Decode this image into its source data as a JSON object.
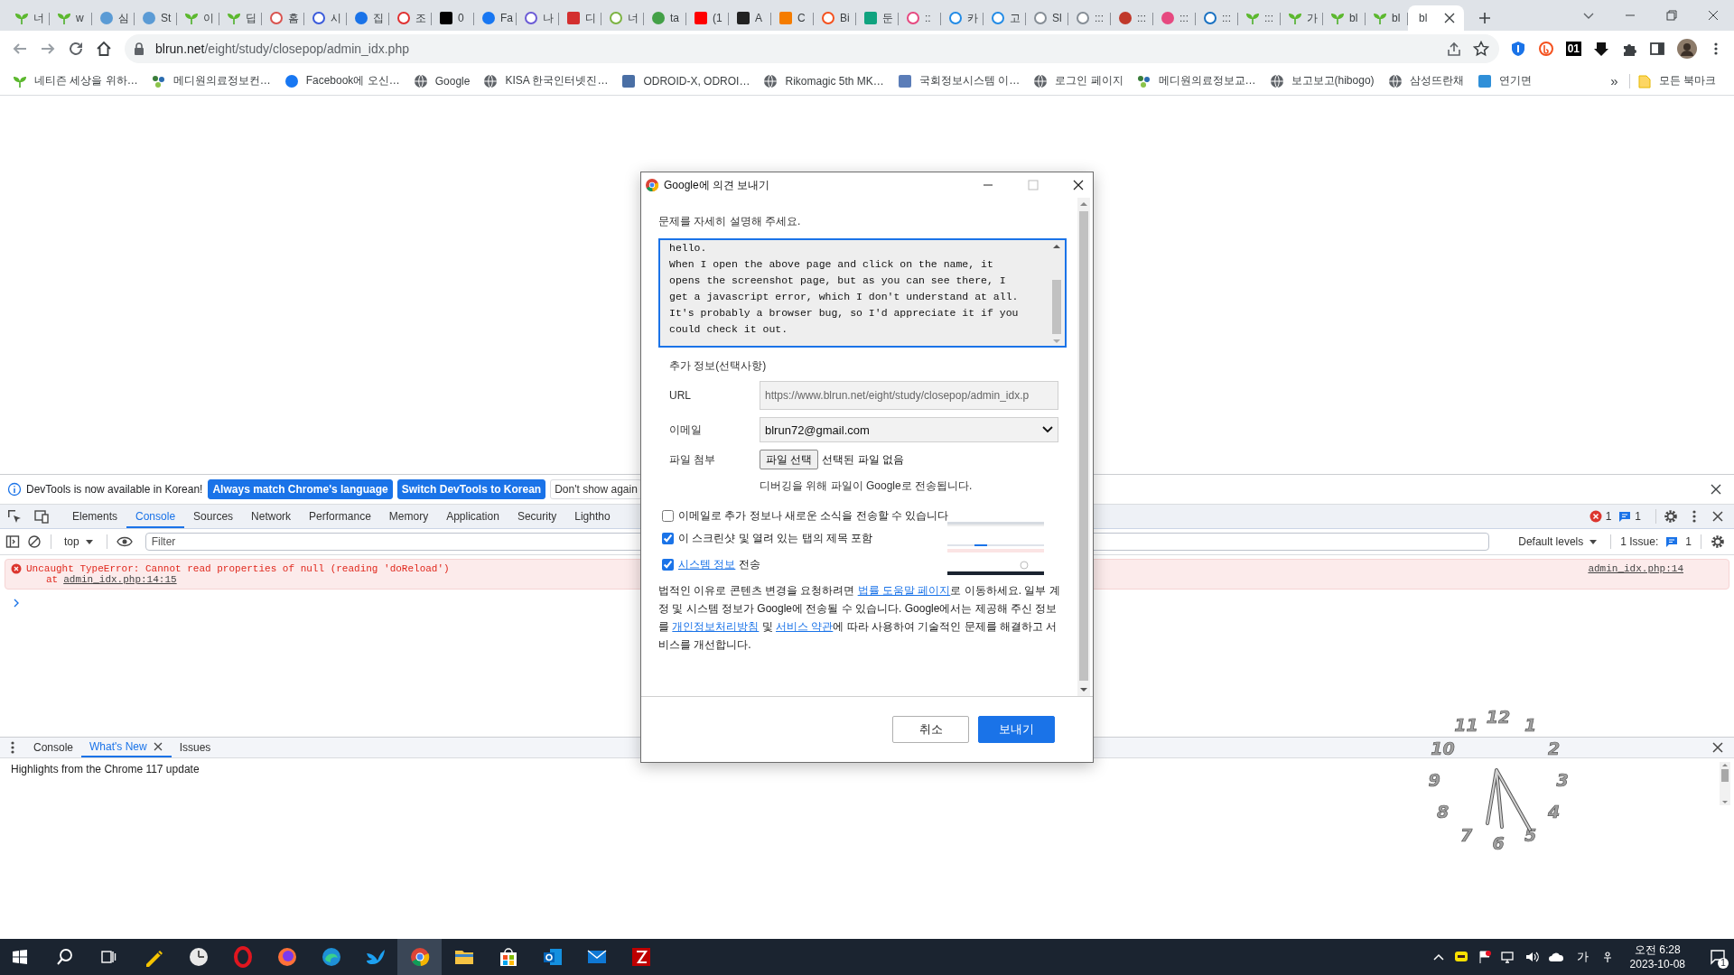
{
  "browser": {
    "tabs": [
      {
        "label": "너",
        "kind": "sprout",
        "selected": false
      },
      {
        "label": "w",
        "kind": "sprout",
        "selected": false
      },
      {
        "label": "심",
        "kind": "disc",
        "color": "#5b9bd5",
        "selected": false
      },
      {
        "label": "St",
        "kind": "disc",
        "color": "#5b9bd5",
        "selected": false
      },
      {
        "label": "이",
        "kind": "sprout",
        "selected": false
      },
      {
        "label": "딥",
        "kind": "sprout",
        "selected": false
      },
      {
        "label": "홈",
        "kind": "ring",
        "color": "#d9534f",
        "selected": false
      },
      {
        "label": "시",
        "kind": "ring",
        "color": "#3b5bdb",
        "selected": false
      },
      {
        "label": "집",
        "kind": "disc",
        "color": "#1a73e8",
        "selected": false
      },
      {
        "label": "조",
        "kind": "ring",
        "color": "#e03131",
        "selected": false
      },
      {
        "label": "0",
        "kind": "square",
        "color": "#000000",
        "selected": false
      },
      {
        "label": "Fa",
        "kind": "disc",
        "color": "#1877f2",
        "selected": false
      },
      {
        "label": "나",
        "kind": "ring",
        "color": "#6b5bd6",
        "selected": false
      },
      {
        "label": "디",
        "kind": "square",
        "color": "#d32f2f",
        "selected": false
      },
      {
        "label": "너",
        "kind": "ring",
        "color": "#7cb342",
        "selected": false
      },
      {
        "label": "ta",
        "kind": "disc",
        "color": "#43a047",
        "selected": false
      },
      {
        "label": "(1",
        "kind": "square",
        "color": "#ff0000",
        "selected": false
      },
      {
        "label": "A",
        "kind": "square",
        "color": "#222222",
        "selected": false
      },
      {
        "label": "C",
        "kind": "square",
        "color": "#f57c00",
        "selected": false
      },
      {
        "label": "Bi",
        "kind": "ring",
        "color": "#f4511e",
        "selected": false
      },
      {
        "label": "둔",
        "kind": "square",
        "color": "#10a37f",
        "selected": false
      },
      {
        "label": "::",
        "kind": "ring",
        "color": "#e64980",
        "selected": false
      },
      {
        "label": "카",
        "kind": "ring",
        "color": "#228be6",
        "selected": false
      },
      {
        "label": "고",
        "kind": "ring",
        "color": "#228be6",
        "selected": false
      },
      {
        "label": "Sl",
        "kind": "ring",
        "color": "#868e96",
        "selected": false
      },
      {
        "label": ":::",
        "kind": "ring",
        "color": "#868e96",
        "selected": false
      },
      {
        "label": ":::",
        "kind": "disc",
        "color": "#c0392b",
        "selected": false
      },
      {
        "label": ":::",
        "kind": "disc",
        "color": "#e64980",
        "selected": false
      },
      {
        "label": ":::",
        "kind": "ring",
        "color": "#1971c2",
        "selected": false
      },
      {
        "label": ":::",
        "kind": "sprout",
        "selected": false
      },
      {
        "label": "가",
        "kind": "sprout",
        "selected": false
      },
      {
        "label": "bl",
        "kind": "sprout",
        "selected": false
      },
      {
        "label": "bl",
        "kind": "sprout",
        "selected": false
      },
      {
        "label": "bl",
        "kind": "plain",
        "selected": true
      }
    ],
    "address": {
      "host": "blrun.net",
      "path": "/eight/study/closepop/admin_idx.php"
    },
    "extension_badge": "01",
    "bookmarks": [
      {
        "label": "네티즌 세상을 위하…",
        "kind": "sprout"
      },
      {
        "label": "메디원의료정보컨…",
        "kind": "dots"
      },
      {
        "label": "Facebook에 오신…",
        "kind": "disc",
        "color": "#1877f2"
      },
      {
        "label": "Google",
        "kind": "globe"
      },
      {
        "label": "KISA 한국인터넷진…",
        "kind": "globe"
      },
      {
        "label": "ODROID-X, ODROI…",
        "kind": "square",
        "color": "#4a6fa5"
      },
      {
        "label": "Rikomagic 5th MK…",
        "kind": "globe"
      },
      {
        "label": "국회정보시스템 이…",
        "kind": "square",
        "color": "#5b7db8"
      },
      {
        "label": "로그인 페이지",
        "kind": "globe"
      },
      {
        "label": "메디원의료정보교…",
        "kind": "dots"
      },
      {
        "label": "보고보고(hibogo)",
        "kind": "globe"
      },
      {
        "label": "삼성뜨란채",
        "kind": "globe"
      },
      {
        "label": "연기면",
        "kind": "square",
        "color": "#2f8fd8"
      }
    ],
    "bookmarks_overflow": "»",
    "all_bookmarks": "모든 북마크"
  },
  "devtools": {
    "infobar": {
      "message": "DevTools is now available in Korean!",
      "buttons": [
        {
          "label": "Always match Chrome's language",
          "kind": "primary"
        },
        {
          "label": "Switch DevTools to Korean",
          "kind": "primary"
        },
        {
          "label": "Don't show again",
          "kind": "plain"
        }
      ]
    },
    "tabs": [
      {
        "label": "Elements",
        "selected": false
      },
      {
        "label": "Console",
        "selected": true
      },
      {
        "label": "Sources",
        "selected": false
      },
      {
        "label": "Network",
        "selected": false
      },
      {
        "label": "Performance",
        "selected": false
      },
      {
        "label": "Memory",
        "selected": false
      },
      {
        "label": "Application",
        "selected": false
      },
      {
        "label": "Security",
        "selected": false
      },
      {
        "label": "Lightho",
        "selected": false
      }
    ],
    "error_count": "1",
    "message_count": "1",
    "console": {
      "context": "top",
      "filter_placeholder": "Filter",
      "levels": "Default levels",
      "issues_label": "1 Issue:",
      "issues_count": "1"
    },
    "messages": [
      {
        "kind": "error",
        "text": "Uncaught TypeError: Cannot read properties of null (reading 'doReload')",
        "trace_prefix": "at",
        "trace_link": "admin_idx.php:14:15",
        "source": "admin_idx.php:14"
      }
    ],
    "drawer": {
      "tabs": [
        {
          "label": "Console",
          "selected": false,
          "closable": false
        },
        {
          "label": "What's New",
          "selected": true,
          "closable": true
        },
        {
          "label": "Issues",
          "selected": false,
          "closable": false
        }
      ],
      "content": "Highlights from the Chrome 117 update"
    }
  },
  "dialog": {
    "title": "Google에 의견 보내기",
    "prompt": "문제를 자세히 설명해 주세요.",
    "description": "hello.\nWhen I open the above page and click on the name, it\nopens the screenshot page, but as you can see there, I\nget a javascript error, which I don't understand at all.\nIt's probably a browser bug, so I'd appreciate it if you\ncould check it out.",
    "section": "추가 정보(선택사항)",
    "fields": [
      {
        "label": "URL",
        "kind": "readonly",
        "value": "https://www.blrun.net/eight/study/closepop/admin_idx.p"
      },
      {
        "label": "이메일",
        "kind": "select",
        "value": "blrun72@gmail.com"
      },
      {
        "label": "파일 첨부",
        "kind": "file",
        "button": "파일 선택",
        "value": "선택된 파일 없음"
      }
    ],
    "file_note": "디버깅을 위해 파일이 Google로 전송됩니다.",
    "options": [
      {
        "checked": false,
        "parts": [
          {
            "kind": "text",
            "text": "이메일로 추가 정보나 새로운 소식을 전송할 수 있습니다"
          }
        ]
      },
      {
        "checked": true,
        "parts": [
          {
            "kind": "text",
            "text": "이 스크린샷 및 열려 있는 탭의 제목 포함"
          }
        ]
      },
      {
        "checked": true,
        "parts": [
          {
            "kind": "link",
            "text": "시스템 정보"
          },
          {
            "kind": "text",
            "text": " 전송"
          }
        ]
      }
    ],
    "legal": [
      {
        "kind": "text",
        "text": "법적인 이유로 콘텐츠 변경을 요청하려면 "
      },
      {
        "kind": "link",
        "text": "법률 도움말 페이지"
      },
      {
        "kind": "text",
        "text": "로 이동하세요. 일부 계정 및 시스템 정보가 Google에 전송될 수 있습니다. Google에서는 제공해 주신 정보를 "
      },
      {
        "kind": "link",
        "text": "개인정보처리방침"
      },
      {
        "kind": "text",
        "text": " 및 "
      },
      {
        "kind": "link",
        "text": "서비스 약관"
      },
      {
        "kind": "text",
        "text": "에 따라 사용하여 기술적인 문제를 해결하고 서비스를 개선합니다."
      }
    ],
    "buttons": [
      {
        "label": "취소",
        "kind": "secondary"
      },
      {
        "label": "보내기",
        "kind": "primary"
      }
    ]
  },
  "clock": {
    "right_numerals": [
      "12",
      "1",
      "2",
      "3",
      "4",
      "5",
      "6"
    ],
    "left_numerals": [
      "11",
      "10",
      "9",
      "8",
      "7"
    ]
  },
  "taskbar": {
    "apps": [
      {
        "kind": "pen",
        "selected": false
      },
      {
        "kind": "clock",
        "selected": false
      },
      {
        "kind": "ring",
        "selected": false
      },
      {
        "kind": "fox",
        "selected": false
      },
      {
        "kind": "wave",
        "selected": false
      },
      {
        "kind": "bird",
        "selected": false
      },
      {
        "kind": "browser",
        "selected": true
      },
      {
        "kind": "folder",
        "selected": false
      },
      {
        "kind": "bag",
        "selected": false
      },
      {
        "kind": "mailbox",
        "selected": false
      },
      {
        "kind": "envelope",
        "selected": false
      },
      {
        "kind": "zap",
        "selected": false
      }
    ],
    "ime": "가",
    "time": "오전 6:28",
    "date": "2023-10-08",
    "notifications": "1"
  }
}
